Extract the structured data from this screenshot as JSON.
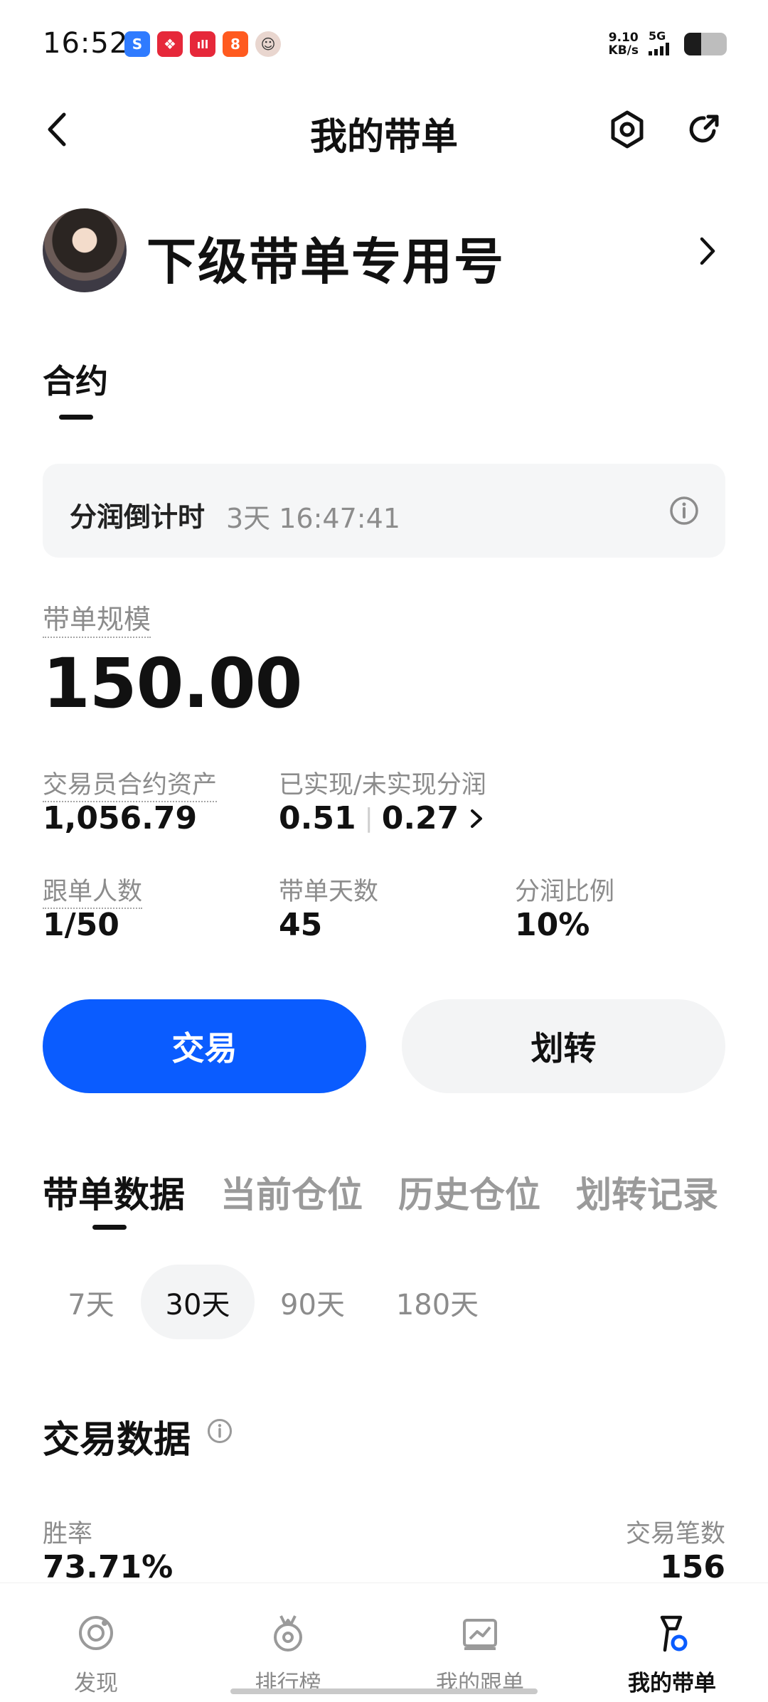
{
  "status_bar": {
    "time": "16:52",
    "net_speed_value": "9.10",
    "net_speed_unit": "KB/s",
    "network": "5G",
    "app_icons": [
      {
        "name": "app-icon-1",
        "color": "#2f7bff",
        "glyph": "S"
      },
      {
        "name": "app-icon-2",
        "color": "#e6283a",
        "glyph": "❖"
      },
      {
        "name": "app-icon-3",
        "color": "#e6283a",
        "glyph": "ıll"
      },
      {
        "name": "app-icon-4",
        "color": "#ff5a1f",
        "glyph": "8"
      },
      {
        "name": "app-icon-5",
        "color": "#e9d6cf",
        "glyph": "☺"
      }
    ]
  },
  "header": {
    "title": "我的带单",
    "icons": [
      "back-icon",
      "settings-icon",
      "share-icon"
    ]
  },
  "trader": {
    "name": "下级带单专用号"
  },
  "section_tab": "合约",
  "countdown": {
    "label": "分润倒计时",
    "value": "3天 16:47:41"
  },
  "scale": {
    "label": "带单规模",
    "value": "150.00"
  },
  "stats": {
    "assets_label": "交易员合约资产",
    "assets_value": "1,056.79",
    "profit_label": "已实现/未实现分润",
    "profit_realized": "0.51",
    "profit_unrealized": "0.27",
    "followers_label": "跟单人数",
    "followers_value": "1/50",
    "days_label": "带单天数",
    "days_value": "45",
    "ratio_label": "分润比例",
    "ratio_value": "10%"
  },
  "buttons": {
    "trade": "交易",
    "transfer": "划转"
  },
  "tabs": [
    "带单数据",
    "当前仓位",
    "历史仓位",
    "划转记录"
  ],
  "periods": [
    "7天",
    "30天",
    "90天",
    "180天"
  ],
  "selected_period": "30天",
  "trade_data": {
    "title": "交易数据",
    "win_rate_label": "胜率",
    "win_rate_value": "73.71%",
    "count_label": "交易笔数",
    "count_value": "156"
  },
  "bottom_nav": [
    {
      "label": "发现",
      "icon": "discover-icon",
      "active": false
    },
    {
      "label": "排行榜",
      "icon": "leaderboard-icon",
      "active": false
    },
    {
      "label": "我的跟单",
      "icon": "copy-trading-icon",
      "active": false
    },
    {
      "label": "我的带单",
      "icon": "lead-trading-icon",
      "active": true
    }
  ],
  "colors": {
    "accent": "#0a5cff",
    "muted_text": "#8c8c8c",
    "light_bg": "#f5f6f7"
  }
}
